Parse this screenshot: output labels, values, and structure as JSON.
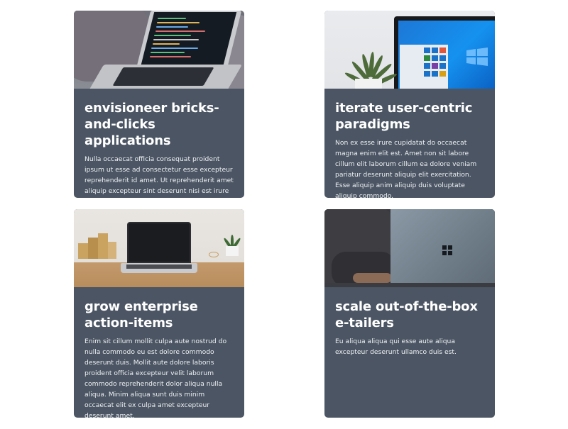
{
  "colors": {
    "card_background": "#4b5563",
    "page_background": "#ffffff",
    "text": "#ffffff"
  },
  "cards": [
    {
      "title": "envisioneer bricks-and-clicks applications",
      "text": "Nulla occaecat officia consequat proident ipsum ut esse ad consectetur esse excepteur reprehenderit id amet. Ut reprehenderit amet aliquip excepteur sint deserunt nisi est irure esse eiusmod dolore ad quis."
    },
    {
      "title": "iterate user-centric paradigms",
      "text": "Non ex esse irure cupidatat do occaecat magna enim elit est. Amet non sit labore cillum elit laborum cillum ea dolore veniam pariatur deserunt aliquip elit exercitation. Esse aliquip anim aliquip duis voluptate aliquip commodo."
    },
    {
      "title": "grow enterprise action-items",
      "text": "Enim sit cillum mollit culpa aute nostrud do nulla commodo eu est dolore commodo deserunt duis. Mollit aute dolore laboris proident officia excepteur velit laborum commodo reprehenderit dolor aliqua nulla aliqua. Minim aliqua sunt duis minim occaecat elit ex culpa amet excepteur deserunt amet."
    },
    {
      "title": "scale out-of-the-box e-tailers",
      "text": "Eu aliqua aliqua qui esse aute aliqua excepteur deserunt ullamco duis est."
    }
  ]
}
